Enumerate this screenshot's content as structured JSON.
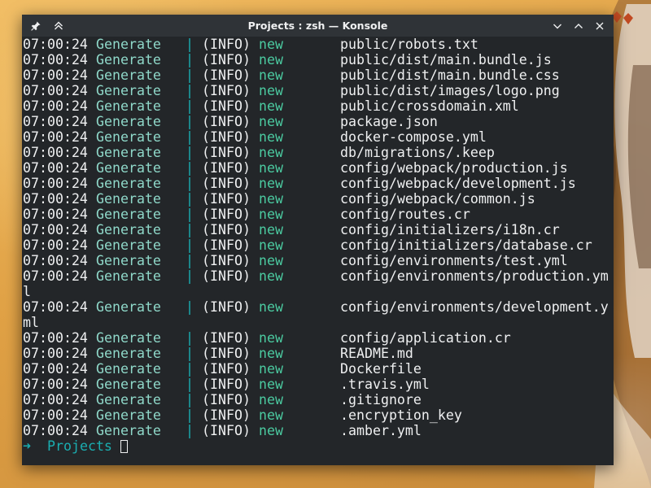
{
  "window": {
    "title": "Projects : zsh — Konsole"
  },
  "titlebar_icons": {
    "left": [
      "pin-icon",
      "keep-above-icon"
    ],
    "right": [
      "minimize-icon",
      "maximize-icon",
      "close-icon"
    ]
  },
  "colors": {
    "background": "#232629",
    "titlebar": "#2f3337",
    "text": "#eff0f1",
    "tag": "#8fd8c9",
    "separator": "#1aaeb1",
    "action": "#4bcaa0",
    "prompt": "#1aaeb1"
  },
  "terminal": {
    "lines": [
      {
        "time": "07:00:24",
        "tag": "Generate",
        "sep": "|",
        "level": "(INFO)",
        "action": "new",
        "path": "public/robots.txt"
      },
      {
        "time": "07:00:24",
        "tag": "Generate",
        "sep": "|",
        "level": "(INFO)",
        "action": "new",
        "path": "public/dist/main.bundle.js"
      },
      {
        "time": "07:00:24",
        "tag": "Generate",
        "sep": "|",
        "level": "(INFO)",
        "action": "new",
        "path": "public/dist/main.bundle.css"
      },
      {
        "time": "07:00:24",
        "tag": "Generate",
        "sep": "|",
        "level": "(INFO)",
        "action": "new",
        "path": "public/dist/images/logo.png"
      },
      {
        "time": "07:00:24",
        "tag": "Generate",
        "sep": "|",
        "level": "(INFO)",
        "action": "new",
        "path": "public/crossdomain.xml"
      },
      {
        "time": "07:00:24",
        "tag": "Generate",
        "sep": "|",
        "level": "(INFO)",
        "action": "new",
        "path": "package.json"
      },
      {
        "time": "07:00:24",
        "tag": "Generate",
        "sep": "|",
        "level": "(INFO)",
        "action": "new",
        "path": "docker-compose.yml"
      },
      {
        "time": "07:00:24",
        "tag": "Generate",
        "sep": "|",
        "level": "(INFO)",
        "action": "new",
        "path": "db/migrations/.keep"
      },
      {
        "time": "07:00:24",
        "tag": "Generate",
        "sep": "|",
        "level": "(INFO)",
        "action": "new",
        "path": "config/webpack/production.js"
      },
      {
        "time": "07:00:24",
        "tag": "Generate",
        "sep": "|",
        "level": "(INFO)",
        "action": "new",
        "path": "config/webpack/development.js"
      },
      {
        "time": "07:00:24",
        "tag": "Generate",
        "sep": "|",
        "level": "(INFO)",
        "action": "new",
        "path": "config/webpack/common.js"
      },
      {
        "time": "07:00:24",
        "tag": "Generate",
        "sep": "|",
        "level": "(INFO)",
        "action": "new",
        "path": "config/routes.cr"
      },
      {
        "time": "07:00:24",
        "tag": "Generate",
        "sep": "|",
        "level": "(INFO)",
        "action": "new",
        "path": "config/initializers/i18n.cr"
      },
      {
        "time": "07:00:24",
        "tag": "Generate",
        "sep": "|",
        "level": "(INFO)",
        "action": "new",
        "path": "config/initializers/database.cr"
      },
      {
        "time": "07:00:24",
        "tag": "Generate",
        "sep": "|",
        "level": "(INFO)",
        "action": "new",
        "path": "config/environments/test.yml"
      },
      {
        "time": "07:00:24",
        "tag": "Generate",
        "sep": "|",
        "level": "(INFO)",
        "action": "new",
        "path": "config/environments/production.ym",
        "wrap": "l"
      },
      {
        "time": "07:00:24",
        "tag": "Generate",
        "sep": "|",
        "level": "(INFO)",
        "action": "new",
        "path": "config/environments/development.y",
        "wrap": "ml"
      },
      {
        "time": "07:00:24",
        "tag": "Generate",
        "sep": "|",
        "level": "(INFO)",
        "action": "new",
        "path": "config/application.cr"
      },
      {
        "time": "07:00:24",
        "tag": "Generate",
        "sep": "|",
        "level": "(INFO)",
        "action": "new",
        "path": "README.md"
      },
      {
        "time": "07:00:24",
        "tag": "Generate",
        "sep": "|",
        "level": "(INFO)",
        "action": "new",
        "path": "Dockerfile"
      },
      {
        "time": "07:00:24",
        "tag": "Generate",
        "sep": "|",
        "level": "(INFO)",
        "action": "new",
        "path": ".travis.yml"
      },
      {
        "time": "07:00:24",
        "tag": "Generate",
        "sep": "|",
        "level": "(INFO)",
        "action": "new",
        "path": ".gitignore"
      },
      {
        "time": "07:00:24",
        "tag": "Generate",
        "sep": "|",
        "level": "(INFO)",
        "action": "new",
        "path": ".encryption_key"
      },
      {
        "time": "07:00:24",
        "tag": "Generate",
        "sep": "|",
        "level": "(INFO)",
        "action": "new",
        "path": ".amber.yml"
      }
    ],
    "prompt": {
      "arrow": "➜",
      "directory": "Projects"
    }
  }
}
